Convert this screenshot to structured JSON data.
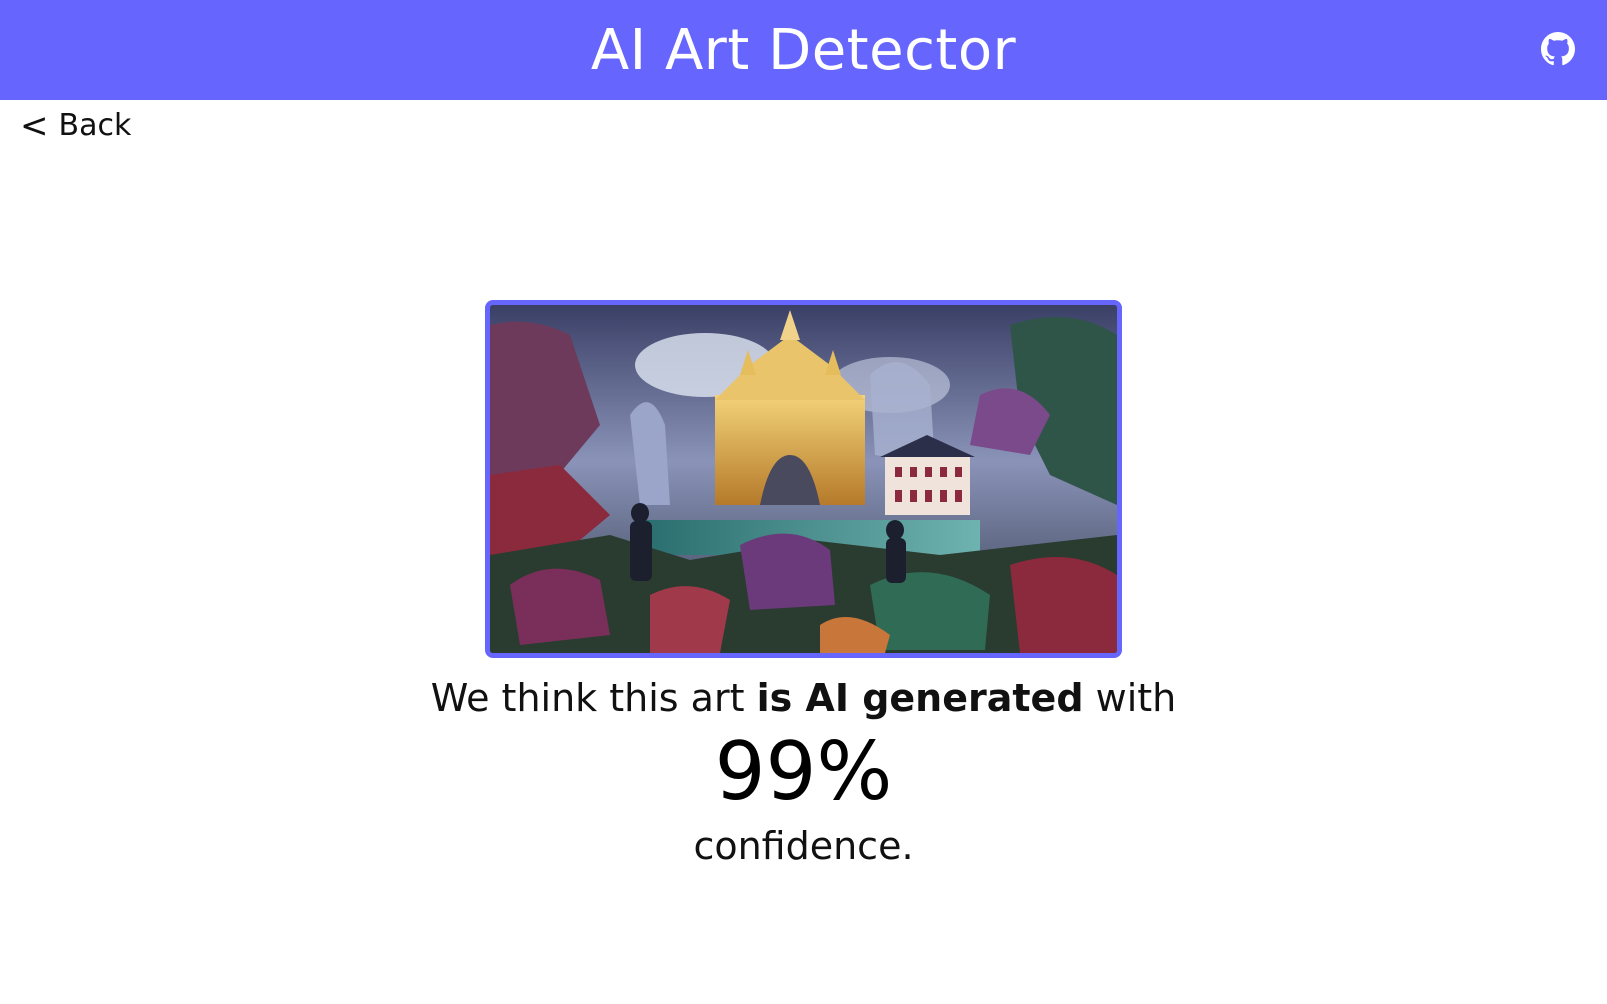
{
  "header": {
    "title": "AI Art Detector",
    "github_icon": "github-icon",
    "background_color": "#6666ff"
  },
  "nav": {
    "back_chevron": "<",
    "back_label": "Back"
  },
  "uploaded_image": {
    "accent_border_color": "#6666ff",
    "alt": "Uploaded artwork"
  },
  "result": {
    "prefix": "We think this art ",
    "verdict": "is AI generated",
    "suffix": " with",
    "confidence": "99%",
    "confidence_label": "confidence."
  }
}
